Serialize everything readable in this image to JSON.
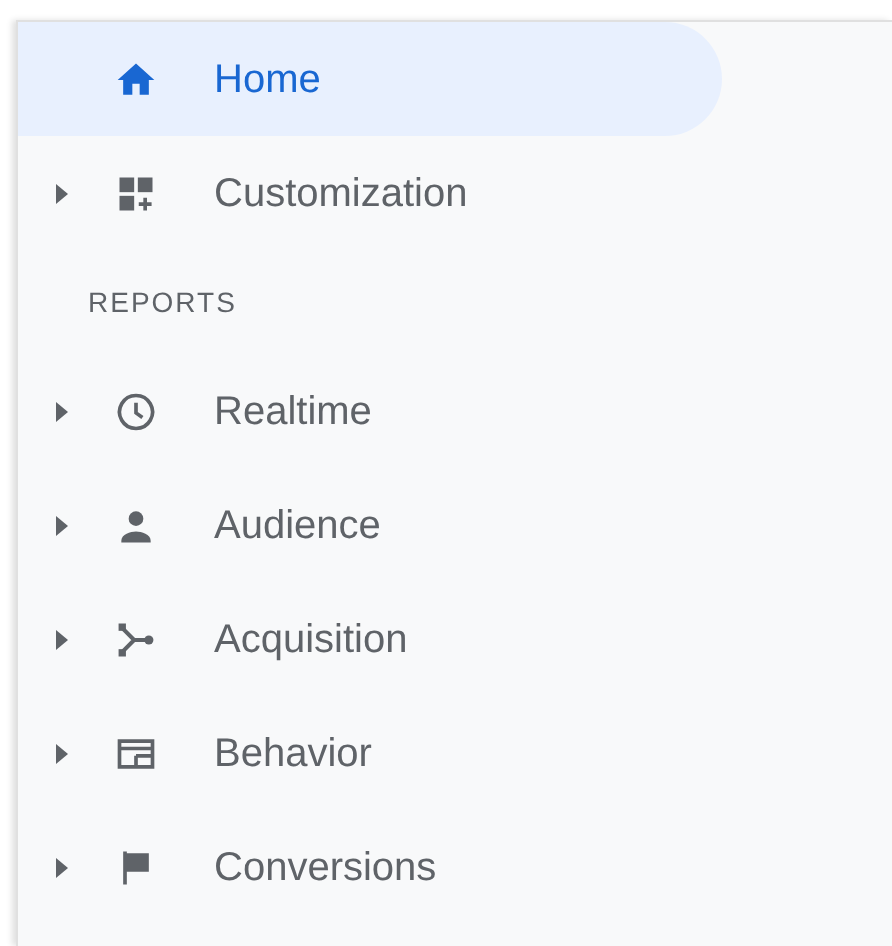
{
  "nav": [
    {
      "label": "Home",
      "expandable": false,
      "selected": true
    },
    {
      "label": "Customization",
      "expandable": true,
      "selected": false
    }
  ],
  "reports": {
    "heading": "REPORTS",
    "items": [
      {
        "label": "Realtime",
        "expandable": true,
        "selected": false
      },
      {
        "label": "Audience",
        "expandable": true,
        "selected": false
      },
      {
        "label": "Acquisition",
        "expandable": true,
        "selected": false
      },
      {
        "label": "Behavior",
        "expandable": true,
        "selected": false
      },
      {
        "label": "Conversions",
        "expandable": true,
        "selected": false
      }
    ]
  }
}
